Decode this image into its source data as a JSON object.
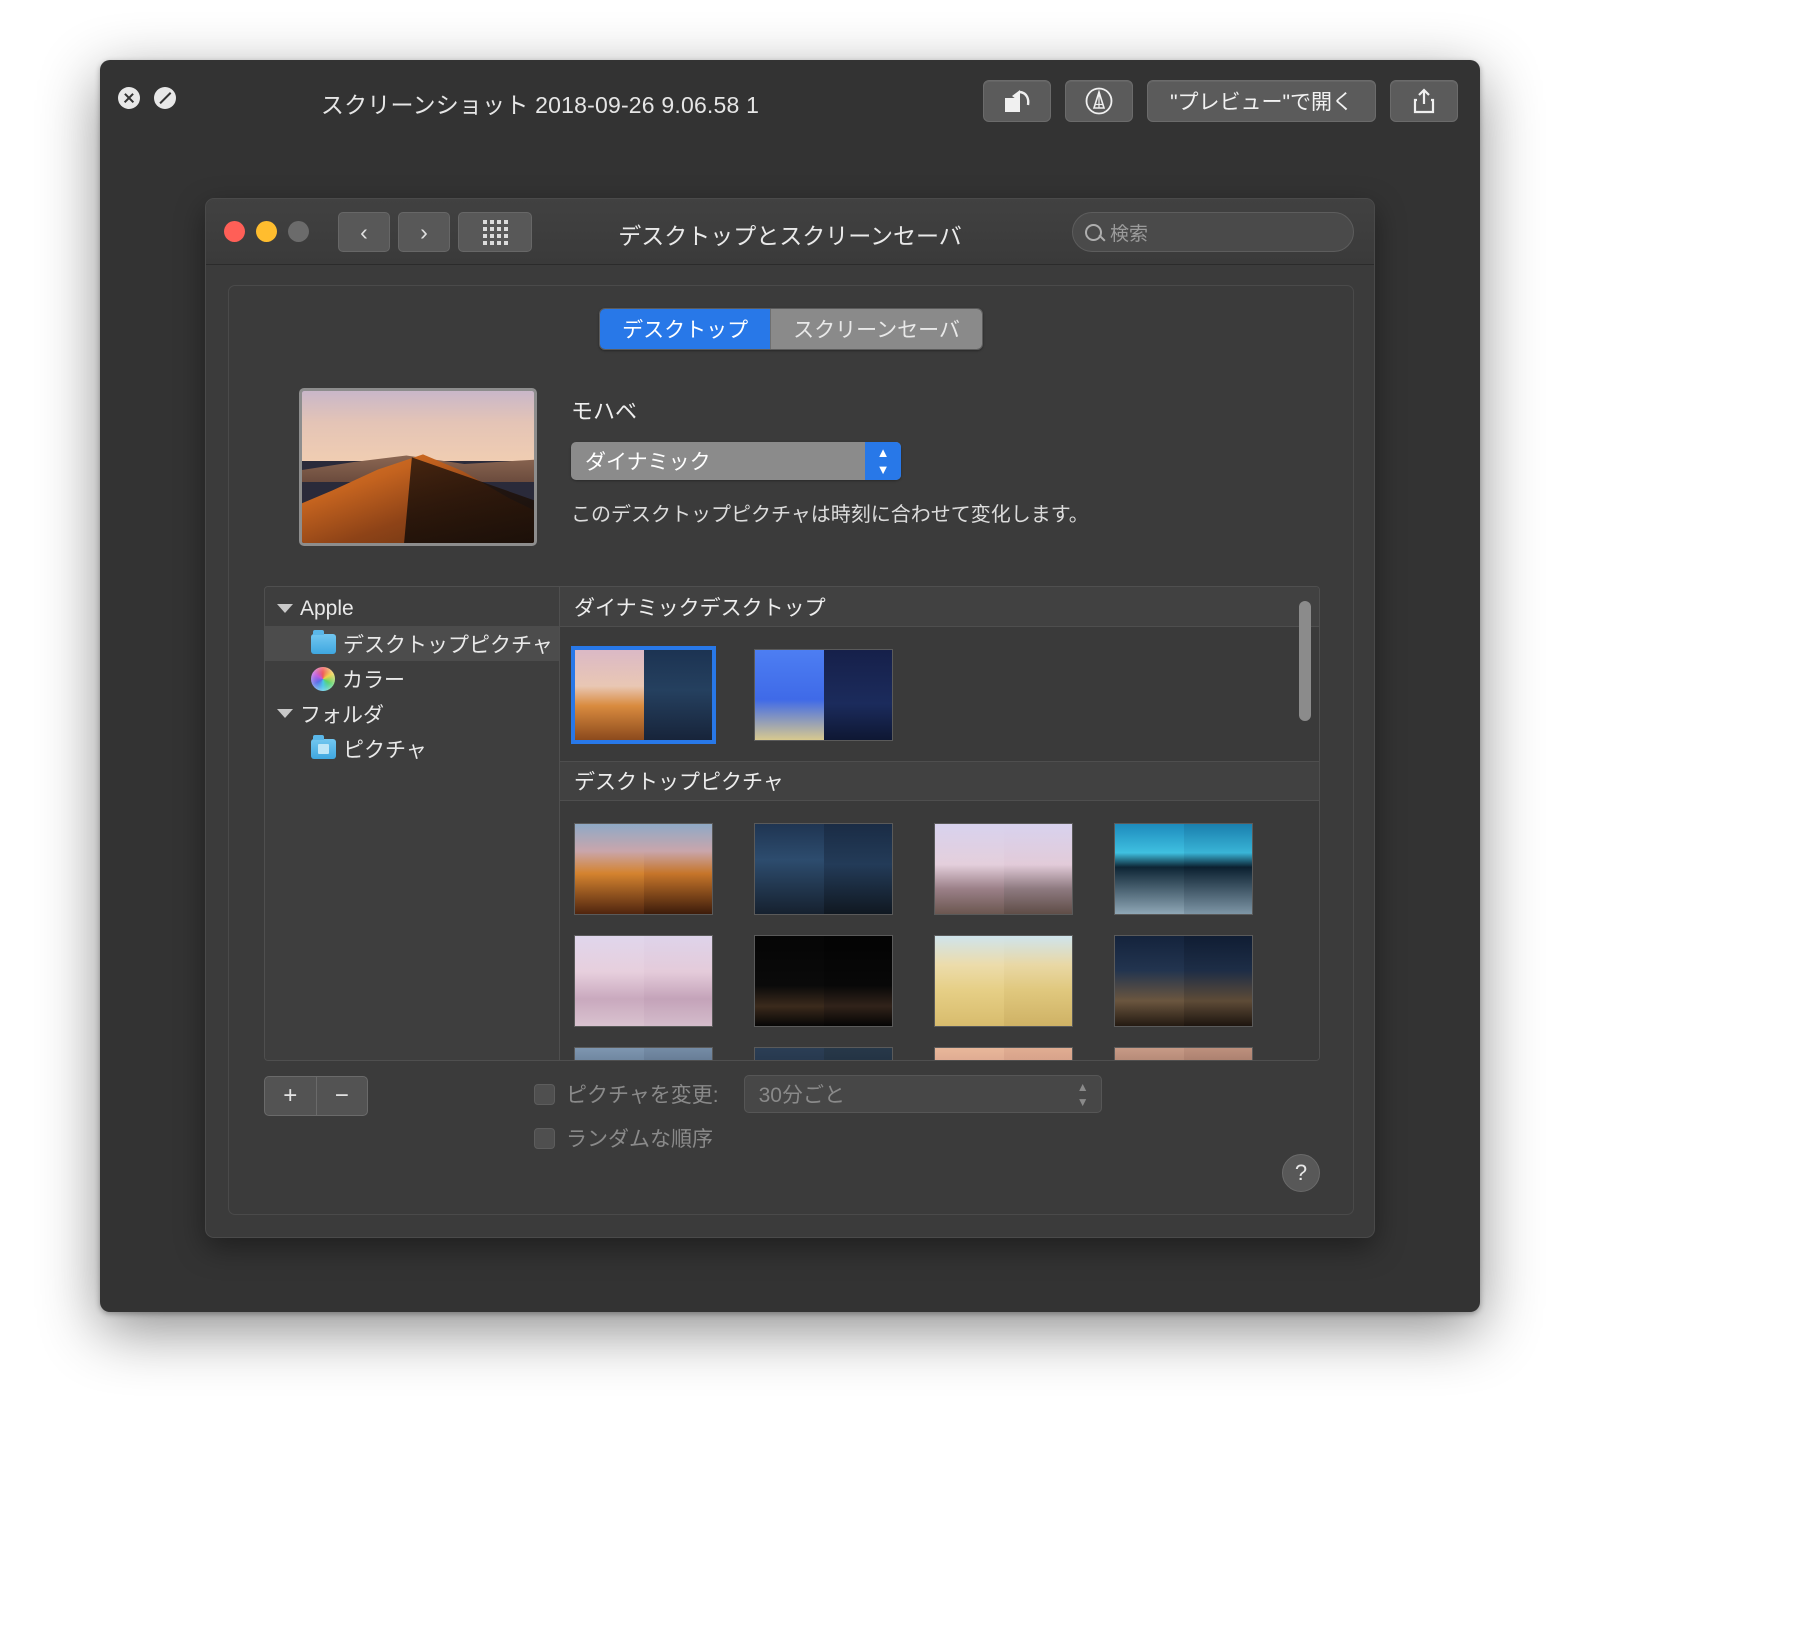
{
  "quicklook": {
    "title": "スクリーンショット 2018-09-26 9.06.58 1",
    "close_icon": "close-x-icon",
    "block_icon": "no-entry-icon",
    "buttons": [
      {
        "name": "rotate-button",
        "label": "",
        "icon": "rotate-left-icon"
      },
      {
        "name": "markup-button",
        "label": "",
        "icon": "markup-pen-icon"
      },
      {
        "name": "open-in-preview-button",
        "label": "\"プレビュー\"で開く",
        "icon": ""
      },
      {
        "name": "share-button",
        "label": "",
        "icon": "share-icon"
      }
    ]
  },
  "prefs_window": {
    "title": "デスクトップとスクリーンセーバ",
    "traffic_lights": [
      "close",
      "minimize",
      "zoom"
    ],
    "nav": {
      "back": "‹",
      "forward": "›",
      "grid": "show-all-grid-icon"
    },
    "search": {
      "placeholder": "検索",
      "value": "",
      "icon": "search-icon"
    }
  },
  "tabs": [
    {
      "label": "デスクトップ",
      "active": true
    },
    {
      "label": "スクリーンセーバ",
      "active": false
    }
  ],
  "desktop_pane": {
    "wallpaper_name": "モハベ",
    "style_select": {
      "value": "ダイナミック",
      "icon": "stepper-up-down-icon"
    },
    "description": "このデスクトップピクチャは時刻に合わせて変化します。",
    "preview_alt": "mojave-dynamic-wallpaper-thumbnail"
  },
  "source_list": [
    {
      "label": "Apple",
      "type": "group",
      "level": 0,
      "icon": "disclosure-triangle-icon",
      "selected": false
    },
    {
      "label": "デスクトップピクチャ",
      "type": "item",
      "level": 1,
      "icon": "folder-icon",
      "selected": true
    },
    {
      "label": "カラー",
      "type": "item",
      "level": 1,
      "icon": "color-wheel-icon",
      "selected": false
    },
    {
      "label": "フォルダ",
      "type": "group",
      "level": 0,
      "icon": "disclosure-triangle-icon",
      "selected": false
    },
    {
      "label": "ピクチャ",
      "type": "item",
      "level": 1,
      "icon": "pictures-folder-icon",
      "selected": false
    }
  ],
  "grid_sections": [
    {
      "header": "ダイナミックデスクトップ",
      "thumbs": [
        {
          "name": "mojave-dynamic",
          "selected": true,
          "left": "linear-gradient(#dbb9c6 0%, #e9c7b4 40%, #d98b3f 62%, #8c4a1d 100%)",
          "right": "linear-gradient(#1c3352 0%, #25405f 45%, #17243a 100%)"
        },
        {
          "name": "solar-gradients-dynamic",
          "selected": false,
          "left": "linear-gradient(#4d7ef2 0%, #3f6ae8 55%, #d8c98f 100%)",
          "right": "linear-gradient(#16204a 0%, #1b2b5c 60%, #0e1733 100%)"
        }
      ]
    },
    {
      "header": "デスクトップピクチャ",
      "thumbs": [
        {
          "name": "mojave-day",
          "selected": false,
          "left": "linear-gradient(#8fa9c6 0%, #c9a6ac 30%, #d4832f 55%, #50250f 100%)",
          "right": "linear-gradient(#8fa9c6 0%, #c9a6ac 30%, #c6752a 55%, #3d1c0b 100%)"
        },
        {
          "name": "mojave-night",
          "selected": false,
          "left": "linear-gradient(#1f3552 0%, #2d4c6e 40%, #16212f 100%)",
          "right": "linear-gradient(#1a2c45 0%, #233b58 45%, #101821 100%)"
        },
        {
          "name": "desert-monument",
          "selected": false,
          "left": "linear-gradient(#d8d2ee 0%, #e4cfdc 45%, #9b8088 72%, #6b5750 100%)",
          "right": "linear-gradient(#d8d2ee 0%, #e2cbd9 45%, #8e7a80 72%, #5f4d47 100%)"
        },
        {
          "name": "lake-blue",
          "selected": false,
          "left": "linear-gradient(#1d8bbd 0%, #3fc0e0 32%, #0d2535 48%, #8fa7b6 100%)",
          "right": "linear-gradient(#1a7fae 0%, #39b4d6 32%, #0b2030 48%, #7e96a6 100%)"
        },
        {
          "name": "salt-flat-rock",
          "selected": false,
          "left": "linear-gradient(#e0d6ec 0%, #e7cfdd 40%, #c9a9be 70%, #d9c2cf 100%)",
          "right": "linear-gradient(#ded3ea 0%, #e4cbda 40%, #c4a3b9 70%, #d4bccb 100%)"
        },
        {
          "name": "black-forest",
          "selected": false,
          "left": "linear-gradient(#050505 0%, #0a0a0a 55%, #3b2a1c 78%, #060606 100%)",
          "right": "linear-gradient(#030303 0%, #080808 55%, #31231a 78%, #040404 100%)"
        },
        {
          "name": "sand-dunes",
          "selected": false,
          "left": "linear-gradient(#cfe4ec 0%, #ecdcab 32%, #e6cf86 60%, #d8bc6d 100%)",
          "right": "linear-gradient(#cfe4ec 0%, #e9d8a5 32%, #e0c87e 60%, #cfb265 100%)"
        },
        {
          "name": "dune-night",
          "selected": false,
          "left": "linear-gradient(#14233c 0%, #22344f 38%, #6b563f 72%, #241a12 100%)",
          "right": "linear-gradient(#101d33 0%, #1d2d46 38%, #5e4b37 72%, #1d150f 100%)"
        },
        {
          "name": "row3-item1",
          "selected": false,
          "left": "linear-gradient(#7e96b0 0%, #4b5f77 50%, #1b2430 100%)",
          "right": "linear-gradient(#758ca6 0%, #44566c 50%, #171f2a 100%)"
        },
        {
          "name": "row3-item2",
          "selected": false,
          "left": "linear-gradient(#2b3e55 0%, #1b2839 60%, #0d141d 100%)",
          "right": "linear-gradient(#273849 0%, #182434 60%, #0b1219 100%)"
        },
        {
          "name": "row3-item3",
          "selected": false,
          "left": "linear-gradient(#e8b79a 0%, #c98e7e 50%, #6d4a45 100%)",
          "right": "linear-gradient(#e0ad92 0%, #c18676 50%, #634340 100%)"
        },
        {
          "name": "row3-item4",
          "selected": false,
          "left": "linear-gradient(#c79a86 0%, #8a6253 50%, #3e2a22 100%)",
          "right": "linear-gradient(#bd907d 0%, #80594c 50%, #36241e 100%)"
        }
      ]
    }
  ],
  "bottom": {
    "add_label": "+",
    "remove_label": "−",
    "change_picture_label": "ピクチャを変更:",
    "interval_value": "30分ごと",
    "random_order_label": "ランダムな順序",
    "help_label": "?"
  },
  "colors": {
    "accent": "#2878e8",
    "window_bg": "#3b3b3b",
    "toolbar_bg": "#333333",
    "text": "#e9e9e9",
    "muted_text": "#8a8a8a"
  }
}
